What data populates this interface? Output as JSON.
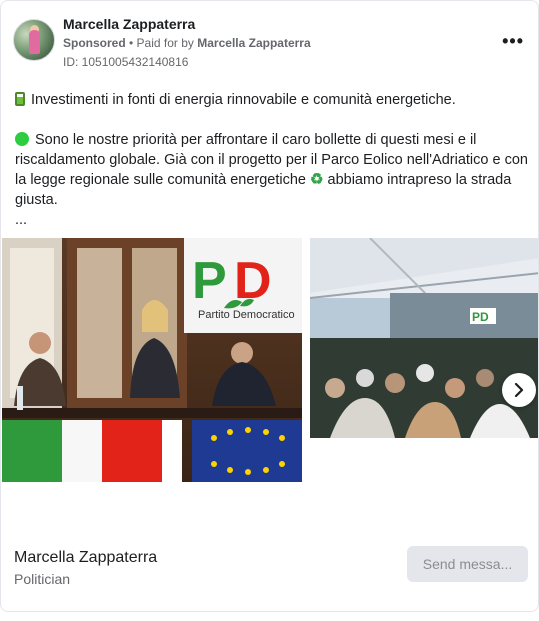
{
  "advertiser": {
    "name": "Marcella Zappaterra",
    "sponsored_label": "Sponsored",
    "paid_for_prefix": " • Paid for by ",
    "paid_for_name": "Marcella Zappaterra",
    "ad_id": "ID: 1051005432140816",
    "more_icon": "more-horizontal-icon"
  },
  "post": {
    "line1": "Investimenti in fonti di energia rinnovabile e comunità energetiche.",
    "line2_a": "Sono le nostre priorità per affrontare il caro bollette di questi mesi e il riscaldamento globale. Già con il progetto per il Parco Eolico nell'Adriatico e con la legge regionale sulle comunità energetiche",
    "line2_b": "abbiamo intrapreso la strada giusta.",
    "ellipsis": "...",
    "emoji1": "battery-icon",
    "emoji2": "green-circle-icon",
    "emoji3": "recycle-icon"
  },
  "carousel": {
    "image1_caption": "Partito Democratico",
    "image1_logo_text": "PD",
    "image2_banner": "PD",
    "next_icon": "chevron-right-icon"
  },
  "footer": {
    "page_name": "Marcella Zappaterra",
    "category": "Politician",
    "cta_label": "Send messa..."
  },
  "colors": {
    "pd_green": "#2f9a3c",
    "pd_red": "#e2231a",
    "eu_blue": "#1f3a93",
    "eu_star": "#ffd200",
    "meta_text": "#65676b"
  }
}
